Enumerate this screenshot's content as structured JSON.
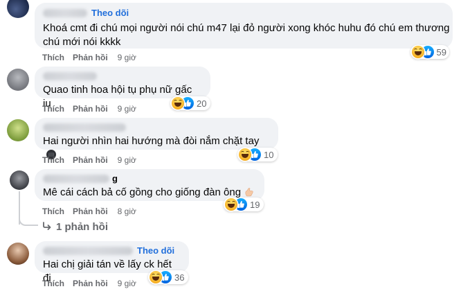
{
  "actions": {
    "like_label": "Thích",
    "reply_label": "Phản hồi"
  },
  "comments": [
    {
      "follow": "Theo dõi",
      "text": "Khoá cmt đi chú mọi người nói chú m47 lại đỏ người xong khóc huhu đó chú em thương chú mới nói kkkk",
      "time": "9 giờ",
      "reaction_count": "59"
    },
    {
      "follow": "",
      "text": "Quao tinh hoa hội tụ phụ nữ gấc iu",
      "time": "9 giờ",
      "reaction_count": "20"
    },
    {
      "follow": "",
      "text": "Hai người nhìn hai hướng mà đòi nắm chặt tay",
      "time": "9 giờ",
      "reaction_count": "10"
    },
    {
      "follow": "",
      "name_fragment": "g",
      "text": "Mê cái cách bả cố gồng cho giống đàn ông",
      "time": "8 giờ",
      "reaction_count": "19",
      "replies_link": "1 phản hồi"
    },
    {
      "follow": "Theo dõi",
      "text": "Hai chị giải tán về lấy ck hết đi",
      "time": "9 giờ",
      "reaction_count": "36"
    }
  ],
  "icons": {
    "haha": "haha-reaction-icon",
    "like": "like-reaction-icon",
    "reply_arrow": "reply-arrow-icon",
    "fist_emoji": "fist-emoji-icon",
    "flex_hand_emoji": "hand-emoji-icon"
  },
  "colors": {
    "bubble": "#f0f2f5",
    "follow_blue": "#216fdb",
    "secondary_text": "#65676b",
    "like_blue": "#1877f2",
    "haha_yellow": "#f7b125"
  }
}
